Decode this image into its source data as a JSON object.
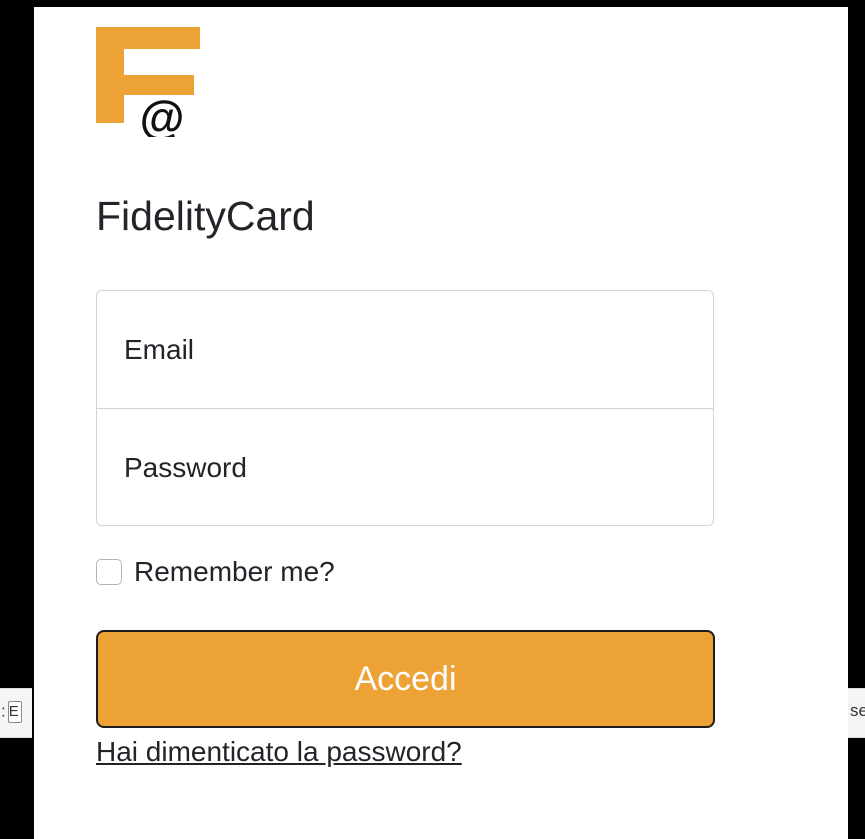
{
  "background": {
    "left_fragment": ":",
    "left_box_char": "E",
    "right_fragment": "se"
  },
  "logo": {
    "primary_color": "#eda236",
    "glyph": "@"
  },
  "app": {
    "title": "FidelityCard"
  },
  "form": {
    "email_placeholder": "Email",
    "password_placeholder": "Password",
    "remember_label": "Remember me?",
    "submit_label": "Accedi",
    "forgot_label": "Hai dimenticato la password?"
  },
  "colors": {
    "accent": "#eda236",
    "text": "#212529",
    "border": "#ced4da"
  }
}
